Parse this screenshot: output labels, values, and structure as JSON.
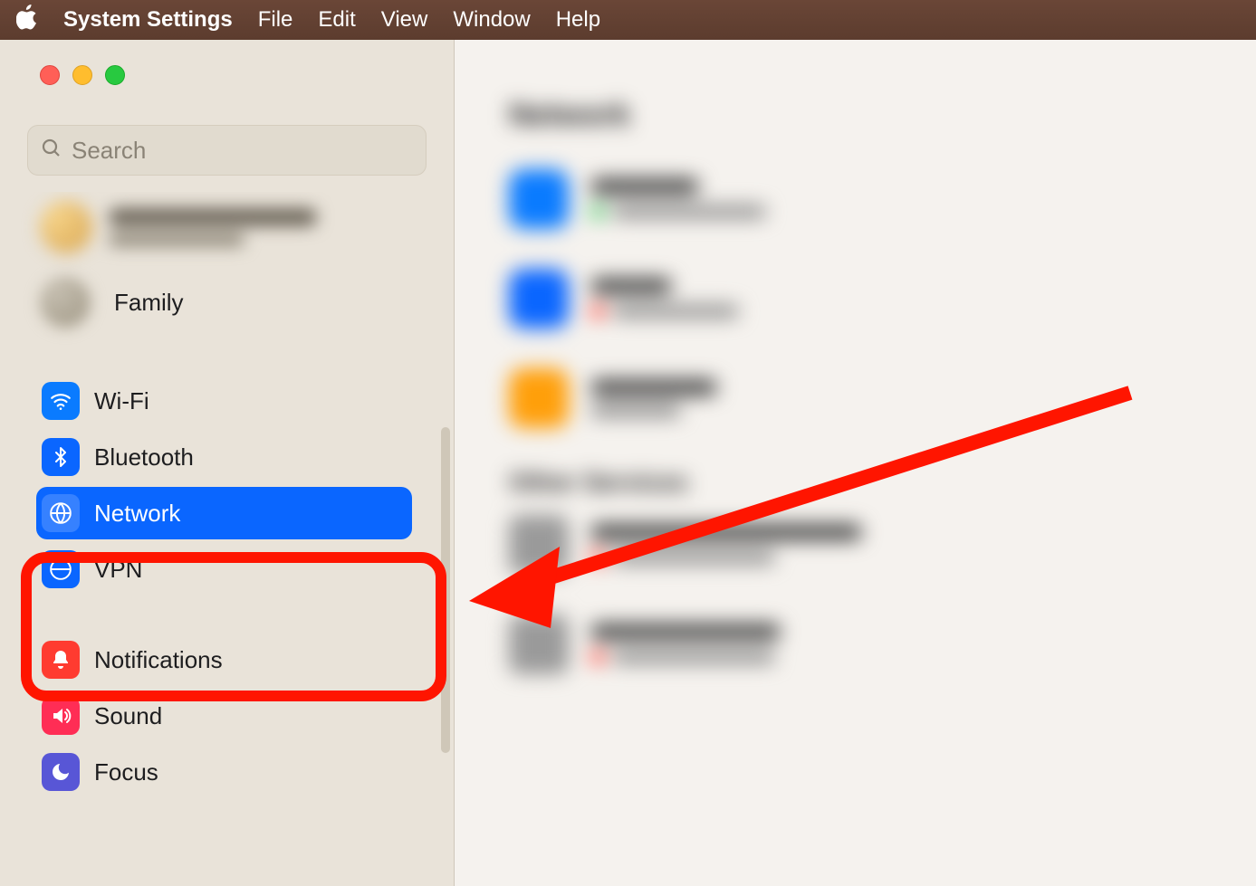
{
  "menubar": {
    "app_name": "System Settings",
    "items": [
      "File",
      "Edit",
      "View",
      "Window",
      "Help"
    ]
  },
  "search": {
    "placeholder": "Search"
  },
  "account": {
    "family_label": "Family"
  },
  "sidebar": {
    "items": [
      {
        "id": "wifi",
        "label": "Wi-Fi",
        "icon": "wifi-icon"
      },
      {
        "id": "bt",
        "label": "Bluetooth",
        "icon": "bluetooth-icon"
      },
      {
        "id": "network",
        "label": "Network",
        "icon": "globe-icon",
        "selected": true
      },
      {
        "id": "vpn",
        "label": "VPN",
        "icon": "vpn-icon"
      },
      {
        "id": "notif",
        "label": "Notifications",
        "icon": "bell-icon"
      },
      {
        "id": "sound",
        "label": "Sound",
        "icon": "speaker-icon"
      },
      {
        "id": "focus",
        "label": "Focus",
        "icon": "moon-icon"
      }
    ]
  },
  "annotation": {
    "color": "#ff1500",
    "highlight_target": "network",
    "has_arrow": true
  }
}
